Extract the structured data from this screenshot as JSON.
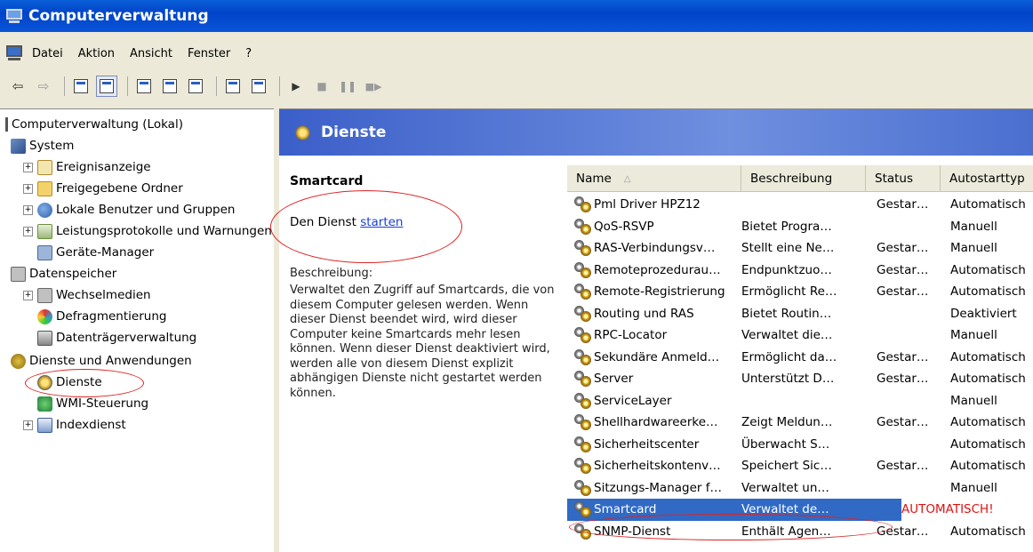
{
  "window": {
    "title": "Computerverwaltung"
  },
  "menu": [
    "Datei",
    "Aktion",
    "Ansicht",
    "Fenster",
    "?"
  ],
  "tree": {
    "root": "Computerverwaltung (Lokal)",
    "system": "System",
    "system_items": [
      "Ereignisanzeige",
      "Freigegebene Ordner",
      "Lokale Benutzer und Gruppen",
      "Leistungsprotokolle und Warnungen",
      "Geräte-Manager"
    ],
    "storage": "Datenspeicher",
    "storage_items": [
      "Wechselmedien",
      "Defragmentierung",
      "Datenträgerverwaltung"
    ],
    "services_apps": "Dienste und Anwendungen",
    "services_items": [
      "Dienste",
      "WMI-Steuerung",
      "Indexdienst"
    ]
  },
  "panel": {
    "header": "Dienste",
    "selected_name": "Smartcard",
    "start_prefix": "Den Dienst ",
    "start_link": "starten",
    "desc_label": "Beschreibung:",
    "desc_text": "Verwaltet den Zugriff auf Smartcards, die von diesem Computer gelesen werden. Wenn dieser Dienst beendet wird, wird dieser Computer keine Smartcards mehr lesen können. Wenn dieser Dienst deaktiviert wird, werden alle von diesem Dienst explizit abhängigen Dienste nicht gestartet werden können."
  },
  "list": {
    "columns": [
      "Name",
      "Beschreibung",
      "Status",
      "Autostarttyp"
    ],
    "rows": [
      [
        "Pml Driver HPZ12",
        "",
        "Gestar…",
        "Automatisch"
      ],
      [
        "QoS-RSVP",
        "Bietet Progra…",
        "",
        "Manuell"
      ],
      [
        "RAS-Verbindungsv…",
        "Stellt eine Ne…",
        "Gestar…",
        "Manuell"
      ],
      [
        "Remoteprozedurau…",
        "Endpunktzuo…",
        "Gestar…",
        "Automatisch"
      ],
      [
        "Remote-Registrierung",
        "Ermöglicht Re…",
        "Gestar…",
        "Automatisch"
      ],
      [
        "Routing und RAS",
        "Bietet Routin…",
        "",
        "Deaktiviert"
      ],
      [
        "RPC-Locator",
        "Verwaltet die…",
        "",
        "Manuell"
      ],
      [
        "Sekundäre Anmeld…",
        "Ermöglicht da…",
        "Gestar…",
        "Automatisch"
      ],
      [
        "Server",
        "Unterstützt D…",
        "Gestar…",
        "Automatisch"
      ],
      [
        "ServiceLayer",
        "",
        "",
        "Manuell"
      ],
      [
        "Shellhardwareerke…",
        "Zeigt Meldun…",
        "Gestar…",
        "Automatisch"
      ],
      [
        "Sicherheitscenter",
        "Überwacht S…",
        "",
        "Automatisch"
      ],
      [
        "Sicherheitskontenv…",
        "Speichert Sic…",
        "Gestar…",
        "Automatisch"
      ],
      [
        "Sitzungs-Manager f…",
        "Verwaltet un…",
        "",
        "Manuell"
      ],
      [
        "Smartcard",
        "Verwaltet de…",
        "",
        "AUTOMATISCH!"
      ],
      [
        "SNMP-Dienst",
        "Enthält Agen…",
        "Gestar…",
        "Automatisch"
      ]
    ],
    "selected_index": 14
  }
}
